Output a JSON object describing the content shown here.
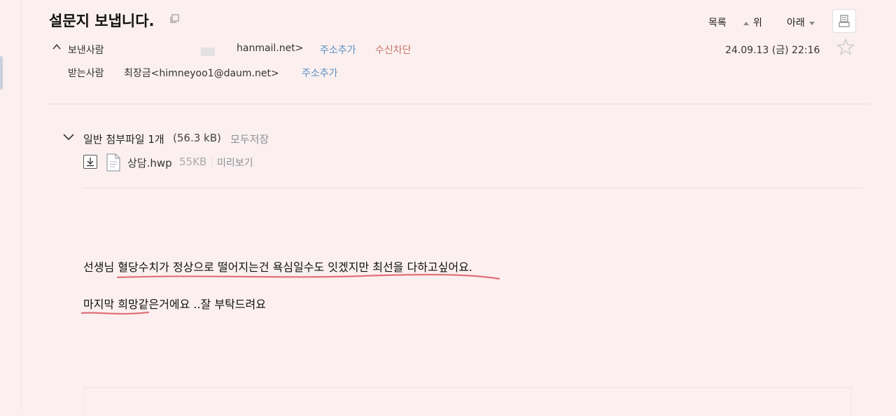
{
  "header": {
    "subject": "설문지 보냅니다.",
    "list_label": "목록",
    "up_label": "위",
    "down_label": "아래"
  },
  "sender": {
    "label": "보낸사람",
    "email": "hanmail.net>",
    "add_label": "주소추가",
    "block_label": "수신차단",
    "date": "24.09.13 (금) 22:16"
  },
  "recipient": {
    "label": "받는사람",
    "name": "최장금<himneyoo1@daum.net>",
    "add_label": "주소추가"
  },
  "attachments": {
    "title": "일반 첨부파일 1개",
    "total_size": "(56.3 kB)",
    "save_all_label": "모두저장",
    "files": [
      {
        "name": "상담.hwp",
        "size": "55KB",
        "preview_label": "미리보기"
      }
    ]
  },
  "body": {
    "lines": [
      "선생님 혈당수치가 정상으로 떨어지는건 욕심일수도 잇겠지만  최선을 다하고싶어요.",
      "마지막 희망같은거에요 ..잘 부탁드려요"
    ]
  },
  "colors": {
    "background": "#fbf0ef",
    "link_blue": "#5a8fc4",
    "block_red": "#c8766a",
    "underline_red": "#e0707a"
  }
}
